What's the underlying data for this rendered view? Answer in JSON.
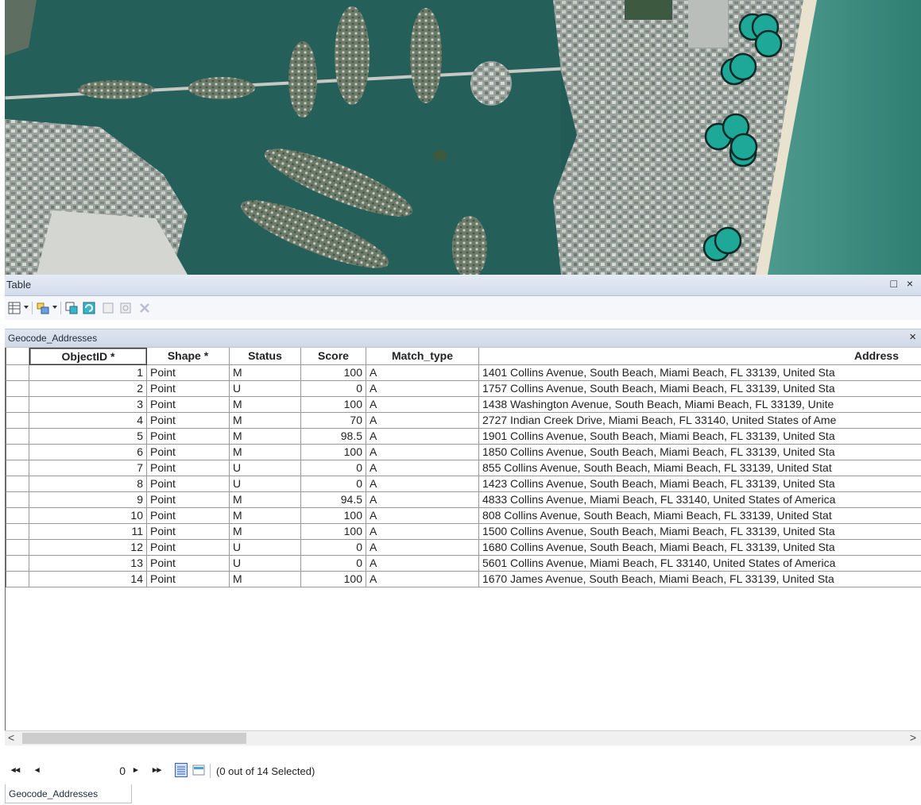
{
  "window": {
    "title": "Table",
    "controls": "□ ×"
  },
  "toolbar": {
    "icons": [
      "table-options-icon",
      "related-tables-icon",
      "select-by-attributes-icon",
      "switch-selection-icon",
      "clear-selection-icon",
      "zoom-to-selected-icon",
      "delete-selected-icon"
    ]
  },
  "table_tab": {
    "name": "Geocode_Addresses",
    "close": "×"
  },
  "columns": [
    "ObjectID *",
    "Shape *",
    "Status",
    "Score",
    "Match_type",
    "Address"
  ],
  "rows": [
    {
      "id": "1",
      "shape": "Point",
      "status": "M",
      "score": "100",
      "match": "A",
      "address": "1401 Collins Avenue, South Beach, Miami Beach, FL 33139, United Sta"
    },
    {
      "id": "2",
      "shape": "Point",
      "status": "U",
      "score": "0",
      "match": "A",
      "address": "1757 Collins Avenue, South Beach, Miami Beach, FL 33139, United Sta"
    },
    {
      "id": "3",
      "shape": "Point",
      "status": "M",
      "score": "100",
      "match": "A",
      "address": "1438 Washington Avenue, South Beach, Miami Beach, FL 33139, Unite"
    },
    {
      "id": "4",
      "shape": "Point",
      "status": "M",
      "score": "70",
      "match": "A",
      "address": "2727 Indian Creek Drive, Miami Beach, FL 33140, United States of Ame"
    },
    {
      "id": "5",
      "shape": "Point",
      "status": "M",
      "score": "98.5",
      "match": "A",
      "address": "1901 Collins Avenue, South Beach, Miami Beach, FL 33139, United Sta"
    },
    {
      "id": "6",
      "shape": "Point",
      "status": "M",
      "score": "100",
      "match": "A",
      "address": "1850 Collins Avenue, South Beach, Miami Beach, FL 33139, United Sta"
    },
    {
      "id": "7",
      "shape": "Point",
      "status": "U",
      "score": "0",
      "match": "A",
      "address": "855 Collins Avenue, South Beach, Miami Beach, FL 33139, United Stat"
    },
    {
      "id": "8",
      "shape": "Point",
      "status": "U",
      "score": "0",
      "match": "A",
      "address": "1423 Collins Avenue, South Beach, Miami Beach, FL 33139, United Sta"
    },
    {
      "id": "9",
      "shape": "Point",
      "status": "M",
      "score": "94.5",
      "match": "A",
      "address": "4833 Collins Avenue, Miami Beach, FL 33140, United States of America"
    },
    {
      "id": "10",
      "shape": "Point",
      "status": "M",
      "score": "100",
      "match": "A",
      "address": "808 Collins Avenue, South Beach, Miami Beach, FL 33139, United Stat"
    },
    {
      "id": "11",
      "shape": "Point",
      "status": "M",
      "score": "100",
      "match": "A",
      "address": "1500 Collins Avenue, South Beach, Miami Beach, FL 33139, United Sta"
    },
    {
      "id": "12",
      "shape": "Point",
      "status": "U",
      "score": "0",
      "match": "A",
      "address": "1680 Collins Avenue, South Beach, Miami Beach, FL 33139, United Sta"
    },
    {
      "id": "13",
      "shape": "Point",
      "status": "U",
      "score": "0",
      "match": "A",
      "address": "5601 Collins Avenue, Miami Beach, FL 33140, United States of America"
    },
    {
      "id": "14",
      "shape": "Point",
      "status": "M",
      "score": "100",
      "match": "A",
      "address": "1670 James Avenue, South Beach, Miami Beach, FL 33139, United Sta"
    }
  ],
  "navigation": {
    "first": "◂◂",
    "prev": "◂",
    "record": "0",
    "next": "▸",
    "last": "▸▸",
    "selection_count": "(0 out of 14 Selected)"
  },
  "scroll": {
    "left": "<",
    "right": ">"
  },
  "bottom_tab": "Geocode_Addresses",
  "colors": {
    "point_fill": "#1ea898",
    "point_stroke": "#0b2a26",
    "water": "#1f5a56",
    "land": "#8c9590"
  }
}
